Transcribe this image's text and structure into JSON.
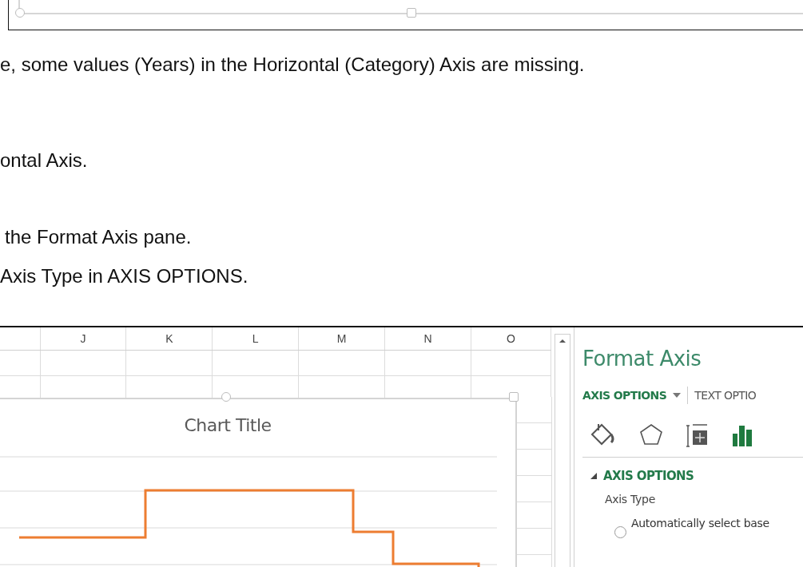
{
  "paragraphs": [
    "e, some values (Years) in the Horizontal (Category) Axis are missing.",
    "ontal Axis.",
    "the Format Axis pane.",
    "Axis Type in AXIS OPTIONS."
  ],
  "spreadsheet": {
    "columns": [
      "J",
      "K",
      "L",
      "M",
      "N",
      "O"
    ],
    "chart": {
      "title": "Chart Title"
    }
  },
  "format_pane": {
    "title": "Format Axis",
    "tabs": [
      {
        "label": "AXIS OPTIONS",
        "selected": true
      },
      {
        "label": "TEXT OPTIO",
        "selected": false
      }
    ],
    "icons": [
      {
        "kind": "fill",
        "selected": false
      },
      {
        "kind": "effects",
        "selected": false
      },
      {
        "kind": "size",
        "selected": false
      },
      {
        "kind": "axis",
        "selected": true
      }
    ],
    "section": {
      "title": "AXIS OPTIONS",
      "expanded": true
    },
    "field_label": "Axis Type",
    "options": [
      {
        "label": "Automatically select base",
        "selected": false
      }
    ]
  }
}
